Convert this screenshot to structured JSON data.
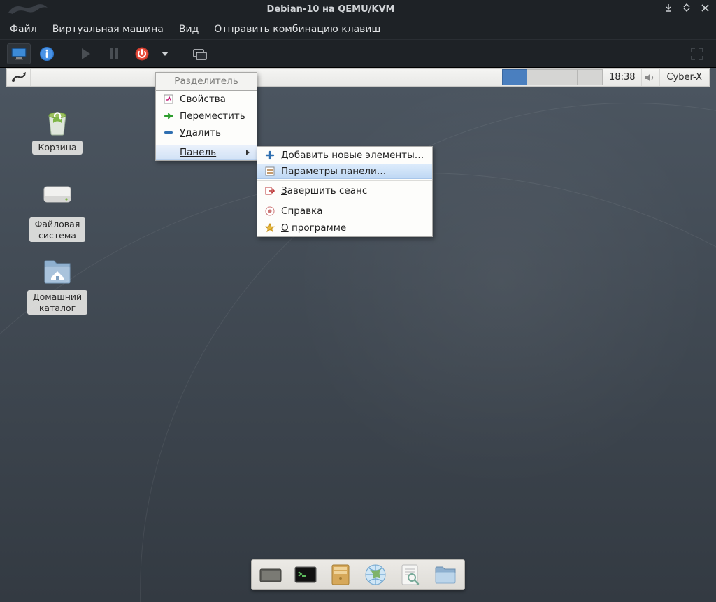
{
  "host": {
    "title": "Debian-10 на QEMU/KVM",
    "menu": {
      "file": "Файл",
      "vm": "Виртуальная машина",
      "view": "Вид",
      "sendkey": "Отправить комбинацию клавиш"
    }
  },
  "panel": {
    "clock": "18:38",
    "user": "Cyber-X"
  },
  "desktop_icons": {
    "trash": "Корзина",
    "filesystem": "Файловая\nсистема",
    "home": "Домашний\nкаталог"
  },
  "ctx": {
    "header": "Разделитель",
    "properties": "Свойства",
    "move": "Переместить",
    "remove": "Удалить",
    "panel": "Панель"
  },
  "sub": {
    "add": "Добавить новые элементы…",
    "prefs": "Параметры панели…",
    "logout": "Завершить сеанс",
    "help": "Справка",
    "about": "О программе"
  },
  "icons": {
    "monitor": "monitor-icon",
    "info": "info-icon",
    "play": "play-icon",
    "pause": "pause-icon",
    "power": "power-icon",
    "dropdown": "chevron-down-icon",
    "screenshot": "screenshot-icon",
    "fullscreen": "fullscreen-icon",
    "apps": "applications-icon",
    "speaker": "speaker-icon",
    "props": "properties-icon",
    "move": "move-icon",
    "remove": "remove-icon",
    "plus": "plus-icon",
    "prefs": "preferences-icon",
    "logout": "logout-icon",
    "help": "help-icon",
    "star": "star-icon",
    "trash": "trash-icon",
    "disk": "disk-icon",
    "home": "home-folder-icon",
    "desk": "show-desktop-icon",
    "term": "terminal-icon",
    "fm": "file-manager-icon",
    "web": "web-browser-icon",
    "search": "app-finder-icon",
    "folder": "folder-icon"
  }
}
